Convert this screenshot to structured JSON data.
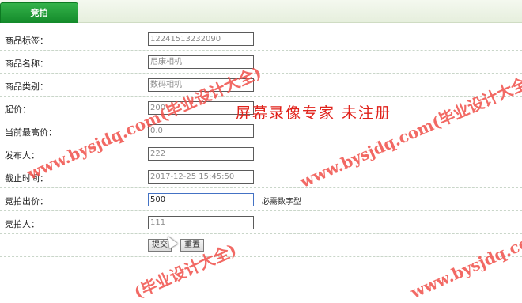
{
  "tab": {
    "label": "竞拍"
  },
  "form": {
    "rows": [
      {
        "label": "商品标签：",
        "value": "12241513232090"
      },
      {
        "label": "商品名称：",
        "value": "尼康相机"
      },
      {
        "label": "商品类别：",
        "value": "数码相机"
      },
      {
        "label": "起价：",
        "value": "200"
      },
      {
        "label": "当前最高价：",
        "value": "0.0"
      },
      {
        "label": "发布人：",
        "value": "222"
      },
      {
        "label": "截止时间：",
        "value": "2017-12-25 15:45:50"
      },
      {
        "label": "竞拍出价：",
        "value": "500",
        "hint": "必需数字型"
      },
      {
        "label": "竞拍人：",
        "value": "111"
      }
    ],
    "submit_label": "提交",
    "reset_label": "重置"
  },
  "watermark": {
    "recorder": "屏幕录像专家  未注册",
    "site1": "www.bysjdq.com(毕业设计大全)",
    "site2": "www.bysjdq.com(毕业设计大全)",
    "site3": "(毕业设计大全)",
    "site4": "www.bysjdq.com(毕业设计大全)"
  }
}
